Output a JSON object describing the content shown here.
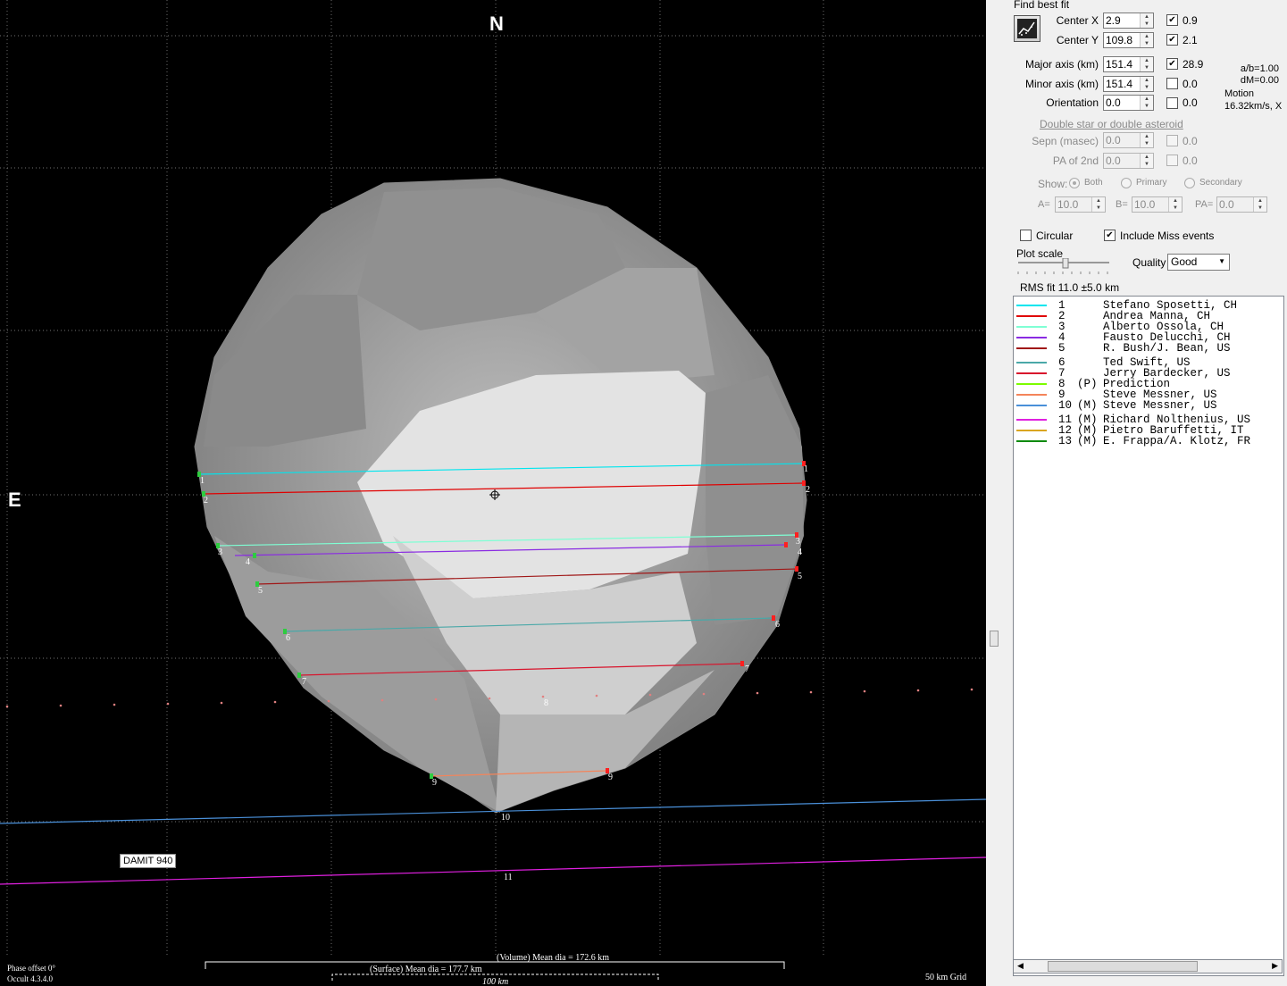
{
  "plot": {
    "north": "N",
    "east": "E",
    "damit_label": "DAMIT 940",
    "volume_dia": "(Volume) Mean dia = 172.6 km",
    "surface_dia": "(Surface) Mean dia = 177.7 km",
    "scale_bar": "100 km",
    "grid_label": "50 km Grid",
    "phase_offset": "Phase offset 0°",
    "version": "Occult 4.3.4.0",
    "chord_numbers": [
      "1",
      "2",
      "3",
      "4",
      "5",
      "6",
      "7",
      "8",
      "9",
      "10",
      "11"
    ]
  },
  "panel": {
    "section_title": "Find best fit",
    "fit_button_icon": "fit-chart-icon",
    "center_x": {
      "label": "Center X",
      "value": "2.9",
      "checked": true,
      "uncert": "0.9"
    },
    "center_y": {
      "label": "Center Y",
      "value": "109.8",
      "checked": true,
      "uncert": "2.1"
    },
    "major_axis": {
      "label": "Major axis (km)",
      "value": "151.4",
      "checked": true,
      "uncert": "28.9"
    },
    "minor_axis": {
      "label": "Minor axis (km)",
      "value": "151.4",
      "checked": false,
      "uncert": "0.0"
    },
    "orientation": {
      "label": "Orientation",
      "value": "0.0",
      "checked": false,
      "uncert": "0.0"
    },
    "ratio": "a/b=1.00",
    "dm": "dM=0.00",
    "motion_label": "Motion",
    "motion_value": "16.32km/s, X",
    "double_link": "Double star  or  double asteroid",
    "sepn": {
      "label": "Sepn (masec)",
      "value": "0.0",
      "uncert": "0.0"
    },
    "pa2": {
      "label": "PA of 2nd",
      "value": "0.0",
      "uncert": "0.0"
    },
    "show_label": "Show:",
    "show_both": "Both",
    "show_primary": "Primary",
    "show_secondary": "Secondary",
    "a_label": "A=",
    "a_value": "10.0",
    "b_label": "B=",
    "b_value": "10.0",
    "pa_label": "PA=",
    "pa_value": "0.0",
    "circular": "Circular",
    "include_miss": "Include Miss events",
    "plot_scale": "Plot scale",
    "quality_label": "Quality",
    "quality_value": "Good",
    "rms_fit": "RMS fit  11.0 ±5.0 km"
  },
  "legend": [
    {
      "num": "1",
      "flag": "",
      "name": "Stefano Sposetti, CH",
      "color": "#00e5ee"
    },
    {
      "num": "2",
      "flag": "",
      "name": "Andrea Manna, CH",
      "color": "#e00000"
    },
    {
      "num": "3",
      "flag": "",
      "name": "Alberto Ossola, CH",
      "color": "#7fffd4"
    },
    {
      "num": "4",
      "flag": "",
      "name": "Fausto Delucchi, CH",
      "color": "#8a2be2"
    },
    {
      "num": "5",
      "flag": "",
      "name": "R. Bush/J. Bean, US",
      "color": "#a01818"
    },
    {
      "num": "6",
      "flag": "",
      "name": "Ted Swift, US",
      "color": "#4aa8a8"
    },
    {
      "num": "7",
      "flag": "",
      "name": "Jerry Bardecker, US",
      "color": "#d8142c"
    },
    {
      "num": "8",
      "flag": "(P)",
      "name": "Prediction",
      "color": "#7cfc00"
    },
    {
      "num": "9",
      "flag": "",
      "name": "Steve Messner, US",
      "color": "#f4845a"
    },
    {
      "num": "10",
      "flag": "(M)",
      "name": "Steve Messner, US",
      "color": "#4a90d9"
    },
    {
      "num": "11",
      "flag": "(M)",
      "name": "Richard Nolthenius, US",
      "color": "#e020e0"
    },
    {
      "num": "12",
      "flag": "(M)",
      "name": "Pietro Baruffetti, IT",
      "color": "#daa520"
    },
    {
      "num": "13",
      "flag": "(M)",
      "name": "E. Frappa/A. Klotz, FR",
      "color": "#0a8a0a"
    }
  ]
}
